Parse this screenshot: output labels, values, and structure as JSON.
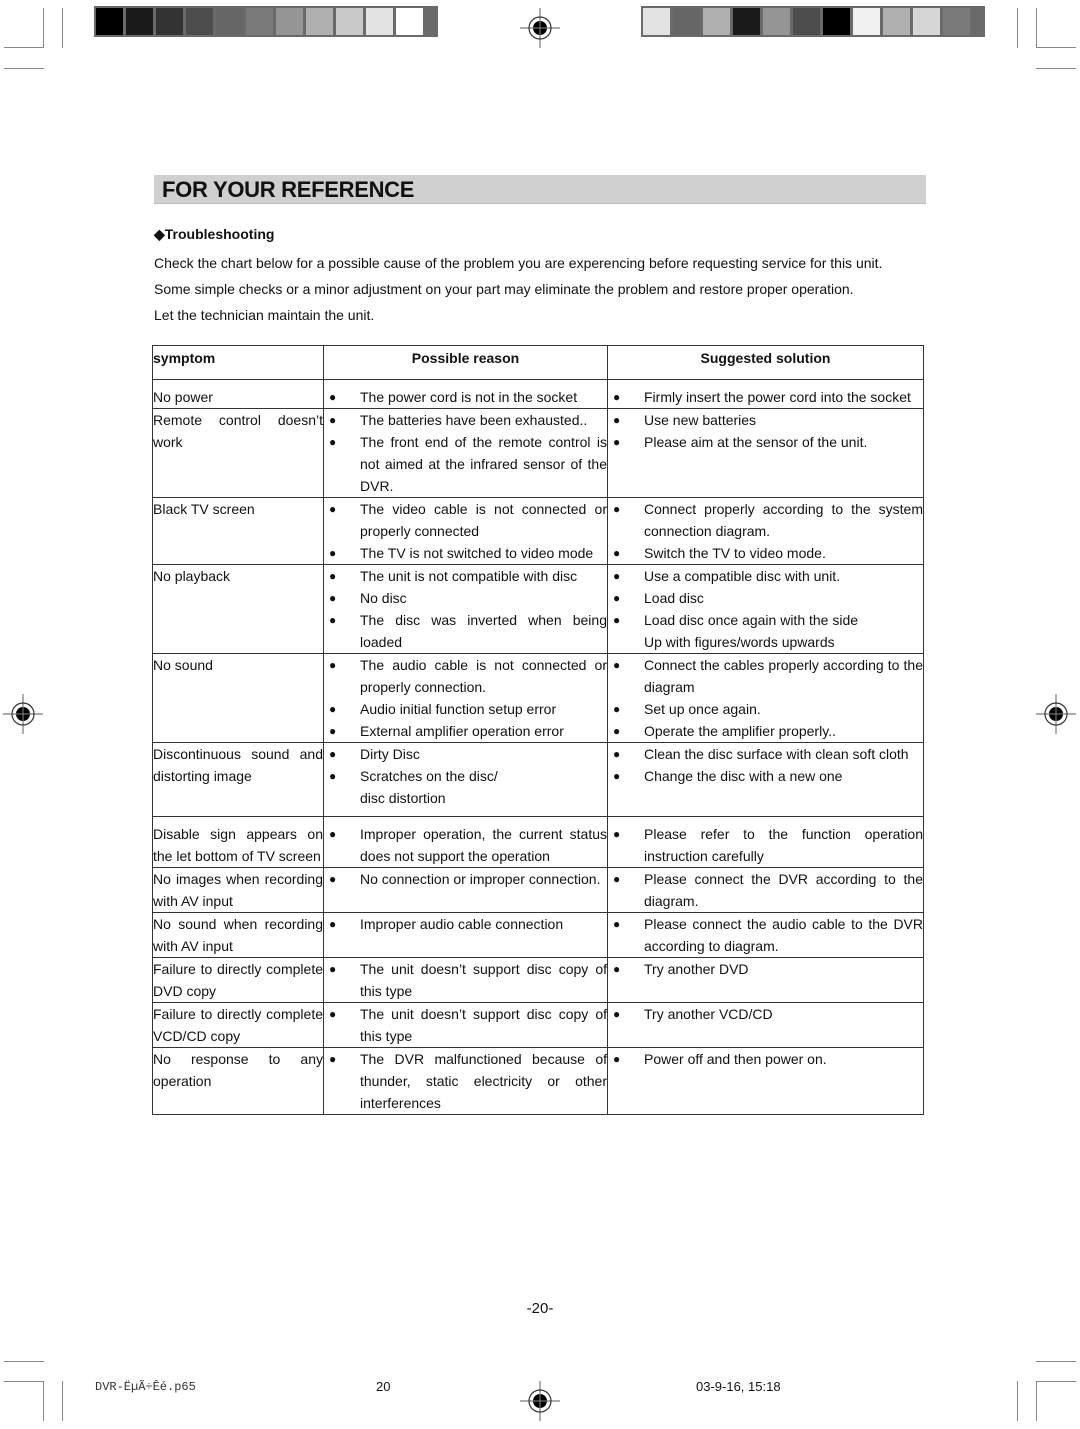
{
  "print_marks": {
    "color_bar_left": [
      "#000000",
      "#1a1a1a",
      "#333333",
      "#4d4d4d",
      "#666666",
      "#7a7a7a",
      "#959595",
      "#b0b0b0",
      "#c9c9c9",
      "#e3e3e3",
      "#ffffff"
    ],
    "color_bar_right": [
      "#e3e3e3",
      "#666666",
      "#b0b0b0",
      "#1a1a1a",
      "#959595",
      "#4d4d4d",
      "#000000",
      "#f0f0f0",
      "#b0b0b0",
      "#d6d6d6",
      "#7a7a7a"
    ]
  },
  "section": {
    "title": "FOR YOUR REFERENCE",
    "header_color": "#d0d0d0"
  },
  "subheading": {
    "icon": "diamond-bullet-icon",
    "glyph": "◆",
    "label": "Troubleshooting"
  },
  "intro": [
    "Check the chart below for a possible cause of the problem you are experencing before requesting service for this unit.",
    "Some simple checks  or a minor adjustment on your part may eliminate the problem and restore proper operation.",
    "Let  the technician maintain the unit."
  ],
  "table": {
    "bullet": "●",
    "headers": {
      "symptom": "symptom",
      "reason": "Possible reason",
      "solution": "Suggested solution"
    },
    "rows": [
      {
        "symptom": [
          "No power"
        ],
        "reasons": [
          {
            "bullet": true,
            "text": "The power cord is not in the socket"
          }
        ],
        "solutions": [
          {
            "bullet": true,
            "text": "Firmly insert the power cord into the socket"
          }
        ]
      },
      {
        "symptom": [
          "Remote control doesn’t work"
        ],
        "reasons": [
          {
            "bullet": true,
            "text": "The batteries have been exhausted.."
          },
          {
            "bullet": true,
            "text": "The front end of the remote control is not aimed at the infrared sensor of the DVR."
          }
        ],
        "solutions": [
          {
            "bullet": true,
            "text": "Use new batteries"
          },
          {
            "bullet": true,
            "text": "Please aim at the sensor of the unit."
          }
        ]
      },
      {
        "symptom": [
          "Black TV screen"
        ],
        "reasons": [
          {
            "bullet": true,
            "text": "The video cable is not connected or properly connected"
          },
          {
            "bullet": true,
            "text": "The TV is not switched to video mode"
          }
        ],
        "solutions": [
          {
            "bullet": true,
            "text": "Connect properly according to the system connection diagram."
          },
          {
            "bullet": true,
            "text": "Switch the TV to video mode."
          }
        ]
      },
      {
        "symptom": [
          "No playback"
        ],
        "reasons": [
          {
            "bullet": true,
            "text": "The unit is not compatible with disc"
          },
          {
            "bullet": true,
            "text": "No disc"
          },
          {
            "bullet": true,
            "text": "The disc was inverted when being loaded"
          }
        ],
        "solutions": [
          {
            "bullet": true,
            "text": "Use a compatible disc with unit."
          },
          {
            "bullet": true,
            "text": "Load disc"
          },
          {
            "bullet": true,
            "text": "Load disc once again with the side"
          },
          {
            "bullet": false,
            "text": "Up with figures/words upwards"
          }
        ]
      },
      {
        "symptom": [
          "No sound"
        ],
        "reasons": [
          {
            "bullet": true,
            "text": "The audio cable is not connected or properly connection."
          },
          {
            "bullet": true,
            "text": "Audio initial function setup error"
          },
          {
            "bullet": true,
            "text": "External amplifier operation error"
          }
        ],
        "solutions": [
          {
            "bullet": true,
            "text": "Connect the cables properly according to the diagram"
          },
          {
            "bullet": true,
            "text": "Set up once again."
          },
          {
            "bullet": true,
            "text": "Operate the amplifier properly.."
          }
        ]
      },
      {
        "symptom": [
          "Discontinuous sound and distorting image"
        ],
        "reasons": [
          {
            "bullet": true,
            "text": "Dirty Disc"
          },
          {
            "bullet": true,
            "text": "Scratches on the disc/"
          },
          {
            "bullet": false,
            "text": "disc distortion"
          }
        ],
        "solutions": [
          {
            "bullet": true,
            "text": "Clean the disc surface with clean soft cloth"
          },
          {
            "bullet": true,
            "text": "Change the disc with a new one"
          }
        ]
      },
      {
        "symptom": [
          "Disable sign appears on the let bottom of TV screen"
        ],
        "reasons": [
          {
            "bullet": true,
            "text": "Improper operation, the current status does not support the operation"
          }
        ],
        "solutions": [
          {
            "bullet": true,
            "text": "Please refer to the function operation instruction carefully"
          }
        ]
      },
      {
        "symptom": [
          "No images when recording with AV input"
        ],
        "reasons": [
          {
            "bullet": true,
            "text": "No connection or improper connection."
          }
        ],
        "solutions": [
          {
            "bullet": true,
            "text": "Please connect the DVR according to the diagram."
          }
        ]
      },
      {
        "symptom": [
          "No sound when recording with AV input"
        ],
        "reasons": [
          {
            "bullet": true,
            "text": "Improper audio cable connection"
          }
        ],
        "solutions": [
          {
            "bullet": true,
            "text": "Please connect the audio cable to the DVR according to diagram."
          }
        ]
      },
      {
        "symptom": [
          "Failure to directly complete DVD copy"
        ],
        "reasons": [
          {
            "bullet": true,
            "text": "The unit doesn’t support disc copy of this type"
          }
        ],
        "solutions": [
          {
            "bullet": true,
            "text": "Try another DVD"
          }
        ]
      },
      {
        "symptom": [
          "Failure to directly complete VCD/CD copy"
        ],
        "reasons": [
          {
            "bullet": true,
            "text": "The unit doesn’t support disc copy of this type"
          }
        ],
        "solutions": [
          {
            "bullet": true,
            "text": "Try another VCD/CD"
          }
        ]
      },
      {
        "symptom": [
          "No response to any operation"
        ],
        "reasons": [
          {
            "bullet": true,
            "text": "The DVR malfunctioned because of thunder, static electricity or other interferences"
          }
        ],
        "solutions": [
          {
            "bullet": true,
            "text": "Power off and then power on."
          }
        ]
      }
    ]
  },
  "page_number": "-20-",
  "footer": {
    "filename": "DVR-ËµÃ÷Êé.p65",
    "page": "20",
    "datetime": "03-9-16, 15:18"
  }
}
